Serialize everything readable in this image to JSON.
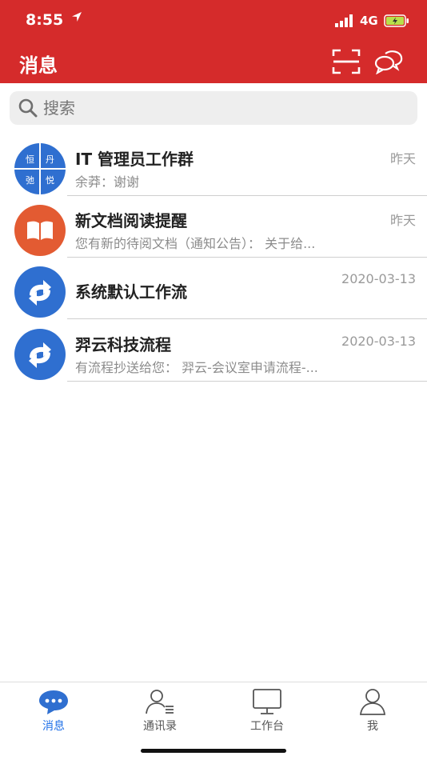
{
  "status_bar": {
    "time": "8:55",
    "network": "4G"
  },
  "header": {
    "title": "消息"
  },
  "search": {
    "placeholder": "搜索"
  },
  "conversations": [
    {
      "avatar_chars": [
        "恒",
        "丹",
        "弛",
        "悦"
      ],
      "title": "IT 管理员工作群",
      "subtitle": "余莽：谢谢",
      "time": "昨天"
    },
    {
      "avatar_icon": "book-icon",
      "title": "新文档阅读提醒",
      "subtitle": "您有新的待阅文档（通知公告）： 关于给...",
      "time": "昨天"
    },
    {
      "avatar_icon": "workflow-icon",
      "title": "系统默认工作流",
      "subtitle": "",
      "time": "2020-03-13"
    },
    {
      "avatar_icon": "workflow-icon",
      "title": "羿云科技流程",
      "subtitle": "有流程抄送给您： 羿云-会议室申请流程-...",
      "time": "2020-03-13"
    }
  ],
  "tabs": [
    {
      "label": "消息",
      "icon": "chat-icon",
      "active": true
    },
    {
      "label": "通讯录",
      "icon": "contacts-icon",
      "active": false
    },
    {
      "label": "工作台",
      "icon": "monitor-icon",
      "active": false
    },
    {
      "label": "我",
      "icon": "user-icon",
      "active": false
    }
  ],
  "colors": {
    "header_bg": "#d52b2b",
    "accent_blue": "#2f6fd0",
    "book_orange": "#e35b32",
    "active_tab": "#1e6fe8"
  }
}
